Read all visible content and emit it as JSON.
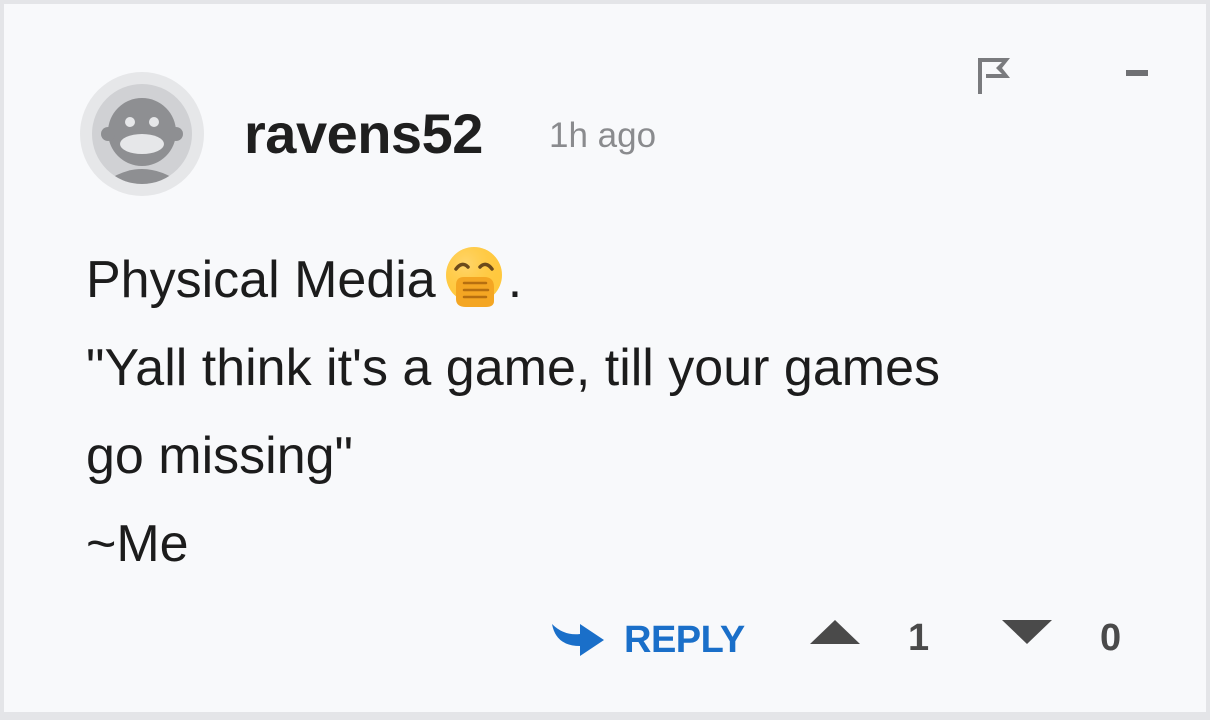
{
  "comment": {
    "username": "ravens52",
    "timestamp": "1h ago",
    "lines": [
      "Physical Media",
      "\"Yall think it's a game, till your games",
      "go missing\"",
      "~Me"
    ],
    "line0_suffix": ".",
    "emoji_name": "face-with-hand-over-mouth"
  },
  "actions": {
    "reply_label": "REPLY",
    "upvotes": "1",
    "downvotes": "0"
  },
  "colors": {
    "background": "#f8f9fb",
    "accent": "#1a6fc9",
    "text": "#1c1c1c",
    "muted": "#8a8b8e"
  }
}
